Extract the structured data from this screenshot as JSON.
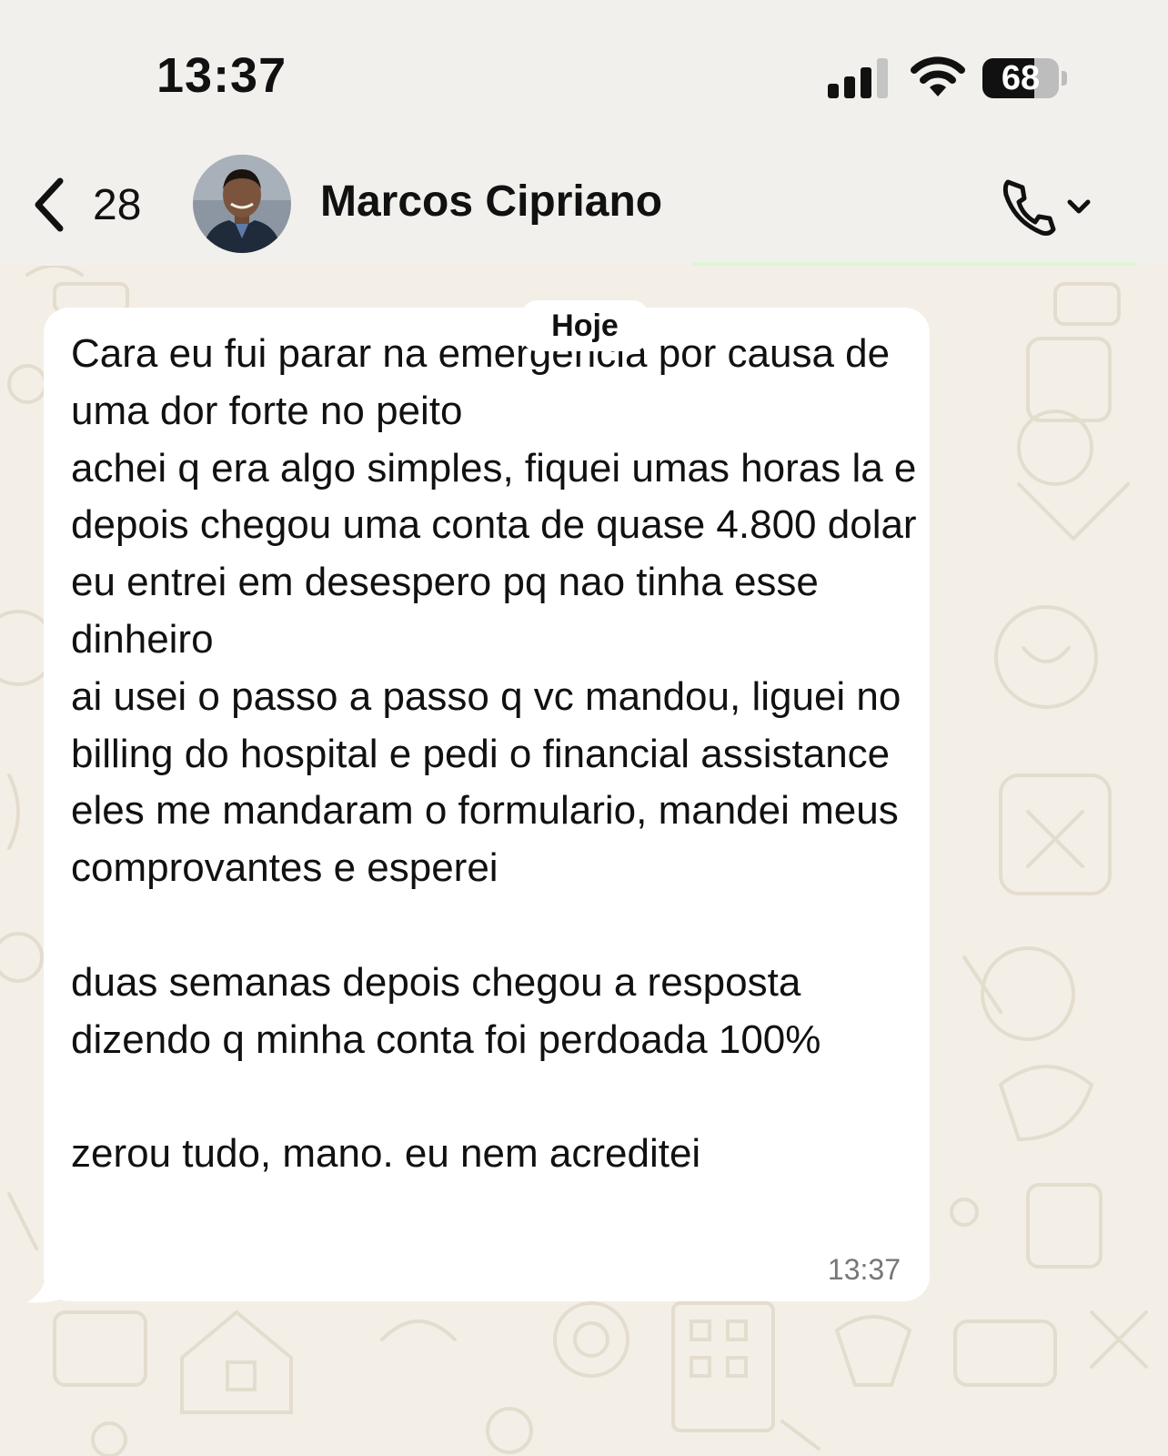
{
  "status_bar": {
    "time": "13:37",
    "battery_level": "68",
    "battery_fraction": 0.68,
    "signal_bars_filled": 3,
    "signal_bars_total": 4
  },
  "header": {
    "back_count": "28",
    "contact_name": "Marcos Cipriano"
  },
  "chat": {
    "date_label": "Hoje",
    "message": {
      "text": "Cara eu fui parar na emergencia por causa de uma dor forte no peito\nachei q era algo simples, fiquei umas horas la e depois chegou uma conta de quase 4.800 dolar\neu entrei em desespero pq nao tinha esse dinheiro\nai usei o passo a passo q vc mandou, liguei no billing do hospital e pedi o financial assistance\neles me mandaram o formulario, mandei meus comprovantes e esperei\n\nduas semanas depois chegou a resposta dizendo q minha conta foi perdoada 100%\n\nzerou tudo, mano. eu nem acreditei",
      "time": "13:37"
    }
  },
  "icons": {
    "back": "chevron-left-icon",
    "call": "phone-icon",
    "call_menu": "chevron-down-icon",
    "signal": "cellular-signal-icon",
    "wifi": "wifi-icon",
    "battery": "battery-icon"
  },
  "colors": {
    "header_bg": "#f1f0ec",
    "wallpaper_bg": "#f3efe7",
    "bubble_bg": "#ffffff",
    "timestamp": "#777777"
  }
}
